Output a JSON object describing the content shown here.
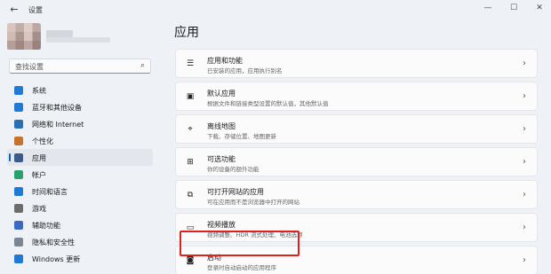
{
  "window": {
    "title": "设置",
    "back_glyph": "←",
    "minimize_glyph": "—",
    "maximize_glyph": "☐",
    "close_glyph": "✕"
  },
  "search": {
    "placeholder": "查找设置",
    "icon": "search-icon"
  },
  "nav": {
    "items": [
      {
        "label": "系统",
        "icon": "system-icon",
        "color": "#1f7ad6"
      },
      {
        "label": "蓝牙和其他设备",
        "icon": "bluetooth-icon",
        "color": "#1f7ad6"
      },
      {
        "label": "网络和 Internet",
        "icon": "network-icon",
        "color": "#2a6fb3"
      },
      {
        "label": "个性化",
        "icon": "personalization-icon",
        "color": "#c7722a"
      },
      {
        "label": "应用",
        "icon": "apps-icon",
        "color": "#3a5a8a",
        "active": true
      },
      {
        "label": "帐户",
        "icon": "account-icon",
        "color": "#2aa06e"
      },
      {
        "label": "时间和语言",
        "icon": "time-language-icon",
        "color": "#1f7ad6"
      },
      {
        "label": "游戏",
        "icon": "gaming-icon",
        "color": "#6c6c6c"
      },
      {
        "label": "辅助功能",
        "icon": "accessibility-icon",
        "color": "#3a6bc4"
      },
      {
        "label": "隐私和安全性",
        "icon": "privacy-icon",
        "color": "#7b8593"
      },
      {
        "label": "Windows 更新",
        "icon": "windows-update-icon",
        "color": "#1f7ad6"
      }
    ]
  },
  "main": {
    "title": "应用",
    "cards": [
      {
        "title": "应用和功能",
        "desc": "已安装的应用，应用执行别名",
        "icon": "apps-features-icon",
        "glyph": "☰"
      },
      {
        "title": "默认应用",
        "desc": "根据文件和链接类型设置的默认值，其他默认值",
        "icon": "default-apps-icon",
        "glyph": "▣"
      },
      {
        "title": "离线地图",
        "desc": "下载、存储位置、地图更新",
        "icon": "offline-maps-icon",
        "glyph": "⌖"
      },
      {
        "title": "可选功能",
        "desc": "你的设备的额外功能",
        "icon": "optional-features-icon",
        "glyph": "⊞"
      },
      {
        "title": "可打开网站的应用",
        "desc": "可在应用而不是浏览器中打开的网站",
        "icon": "apps-for-websites-icon",
        "glyph": "⧉"
      },
      {
        "title": "视频播放",
        "desc": "视频调整、HDR 流式处理、电池选项",
        "icon": "video-playback-icon",
        "glyph": "▭"
      },
      {
        "title": "启动",
        "desc": "登录时自动启动的应用程序",
        "icon": "startup-icon",
        "glyph": "◙"
      }
    ],
    "chevron": "›",
    "highlight_color": "#e0201f"
  }
}
